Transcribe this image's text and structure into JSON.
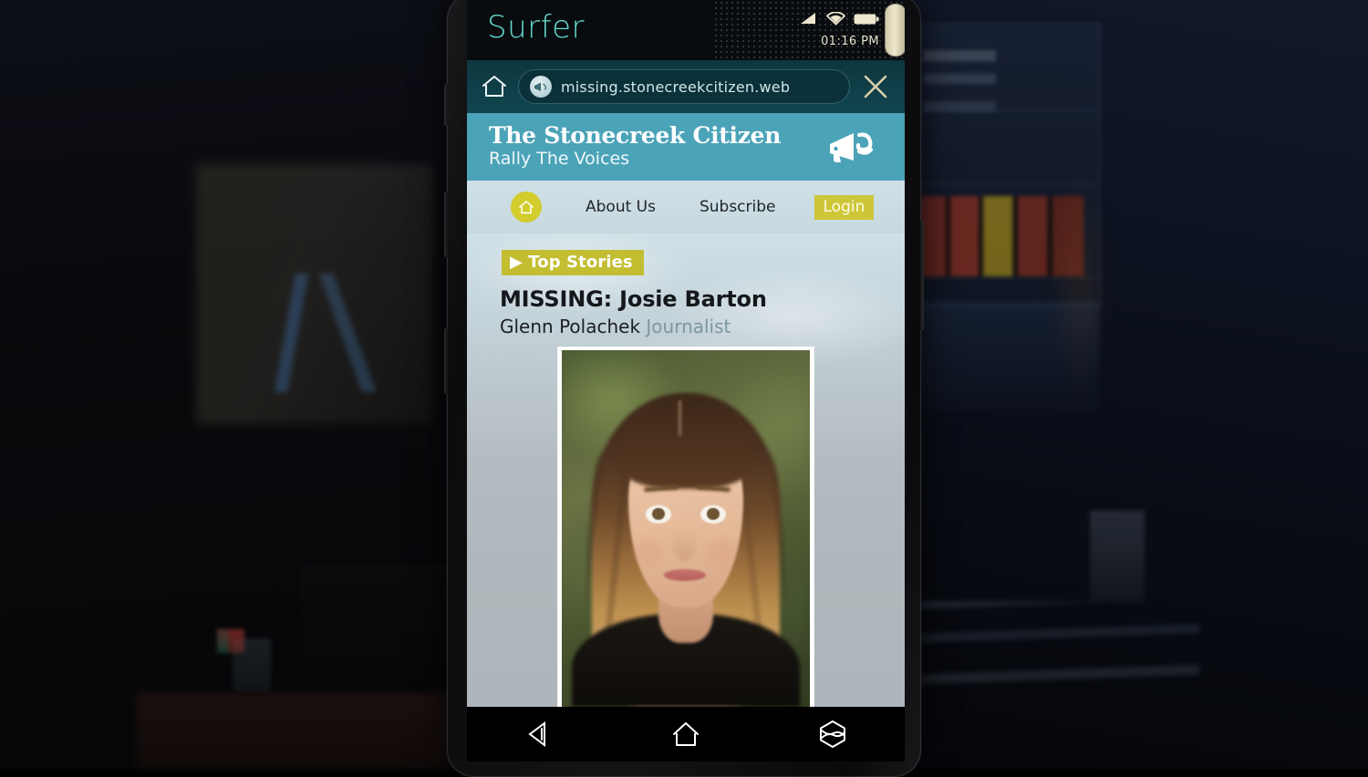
{
  "phone": {
    "status_bar": {
      "app_name": "Surfer",
      "time": "01:16 PM",
      "icons": [
        "signal-icon",
        "wifi-icon",
        "battery-icon"
      ]
    },
    "browser": {
      "home_icon": "home-icon",
      "favicon": "megaphone-favicon",
      "url": "missing.stonecreekcitizen.web",
      "close_icon": "close-icon"
    },
    "android_nav": {
      "back": "back-icon",
      "home": "home-icon",
      "recents": "recents-icon"
    }
  },
  "site": {
    "header": {
      "title": "The Stonecreek Citizen",
      "tagline": "Rally The Voices",
      "logo": "megaphone-logo"
    },
    "nav": {
      "home_icon": "home-icon",
      "items": [
        {
          "label": "About Us"
        },
        {
          "label": "Subscribe"
        }
      ],
      "login_label": "Login"
    },
    "article": {
      "section_badge": "▶ Top Stories",
      "headline": "MISSING: Josie Barton",
      "author": "Glenn Polachek",
      "author_role": "Journalist",
      "photo_alt": "portrait-of-josie-barton"
    }
  },
  "colors": {
    "masthead_teal": "#4ba3b8",
    "urlbar_teal": "#11454f",
    "accent_yellow": "#cdc638",
    "badge_yellow": "#c3bd32",
    "app_title_cyan": "#62d8cf",
    "role_gray_blue": "#7d96a3",
    "page_bg": "#b0b8bd"
  }
}
